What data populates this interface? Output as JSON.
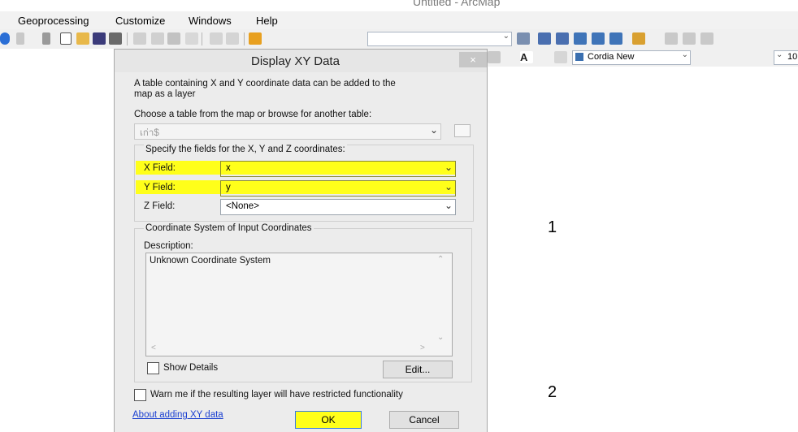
{
  "app": {
    "title": "Untitled - ArcMap"
  },
  "menu": [
    "Geoprocessing",
    "Customize",
    "Windows",
    "Help"
  ],
  "toolbar": {
    "font_name": "Cordia New",
    "font_size": "10"
  },
  "dialog": {
    "title": "Display XY Data",
    "close_label": "×",
    "intro": [
      "A table containing X and Y coordinate data can be added to the",
      "map as a layer"
    ],
    "choose_label": "Choose a table from the map or browse for another table:",
    "table_value": "เก่า$",
    "fields_group_label": "Specify the fields for the X, Y and Z coordinates:",
    "x_label": "X Field:",
    "x_value": "x",
    "y_label": "Y Field:",
    "y_value": "y",
    "z_label": "Z Field:",
    "z_value": "<None>",
    "coord_group_label": "Coordinate System of Input Coordinates",
    "description_label": "Description:",
    "description_value": "Unknown Coordinate System",
    "show_details": "Show Details",
    "edit_button": "Edit...",
    "warn_checkbox": "Warn me if the resulting layer will have restricted functionality",
    "about_link": "About adding XY data",
    "ok_button": "OK",
    "cancel_button": "Cancel"
  },
  "annotations": [
    "1",
    "2"
  ],
  "colors": {
    "highlight": "#ffff1a",
    "link": "#1a3fd1"
  }
}
